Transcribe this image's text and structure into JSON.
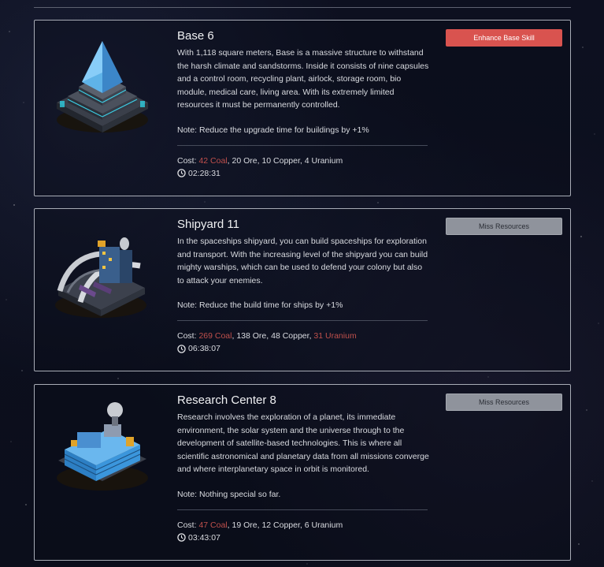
{
  "buildings": [
    {
      "title": "Base 6",
      "description": "With 1,118 square meters, Base is a massive structure to withstand the harsh climate and sandstorms. Inside it consists of nine capsules and a control room, recycling plant, airlock, storage room, bio module, medical care, living area. With its extremely limited resources it must be permanently controlled.",
      "note": "Note: Reduce the upgrade time for buildings by +1%",
      "cost_label": "Cost:",
      "cost": {
        "coal": "42 Coal",
        "ore": "20 Ore",
        "copper": "10 Copper",
        "uranium": "4 Uranium"
      },
      "time": "02:28:31",
      "action_label": "Enhance Base Skill",
      "action_state": "enabled",
      "icon": "base-building-icon"
    },
    {
      "title": "Shipyard 11",
      "description": "In the spaceships shipyard, you can build spaceships for exploration and transport. With the increasing level of the shipyard you can build mighty warships, which can be used to defend your colony but also to attack your enemies.",
      "note": "Note: Reduce the build time for ships by +1%",
      "cost_label": "Cost:",
      "cost": {
        "coal": "269 Coal",
        "ore": "138 Ore",
        "copper": "48 Copper",
        "uranium": "31 Uranium"
      },
      "time": "06:38:07",
      "action_label": "Miss Resources",
      "action_state": "disabled",
      "icon": "shipyard-building-icon"
    },
    {
      "title": "Research Center 8",
      "description": "Research involves the exploration of a planet, its immediate environment, the solar system and the universe through to the development of satellite-based technologies. This is where all scientific astronomical and planetary data from all missions converge and where interplanetary space in orbit is monitored.",
      "note": "Note: Nothing special so far.",
      "cost_label": "Cost:",
      "cost": {
        "coal": "47 Coal",
        "ore": "19 Ore",
        "copper": "12 Copper",
        "uranium": "6 Uranium"
      },
      "time": "03:43:07",
      "action_label": "Miss Resources",
      "action_state": "disabled",
      "icon": "research-center-building-icon"
    }
  ],
  "colors": {
    "insufficient": "#c0504c",
    "enhance_button": "#d9534f",
    "disabled_button": "#8f939c"
  }
}
